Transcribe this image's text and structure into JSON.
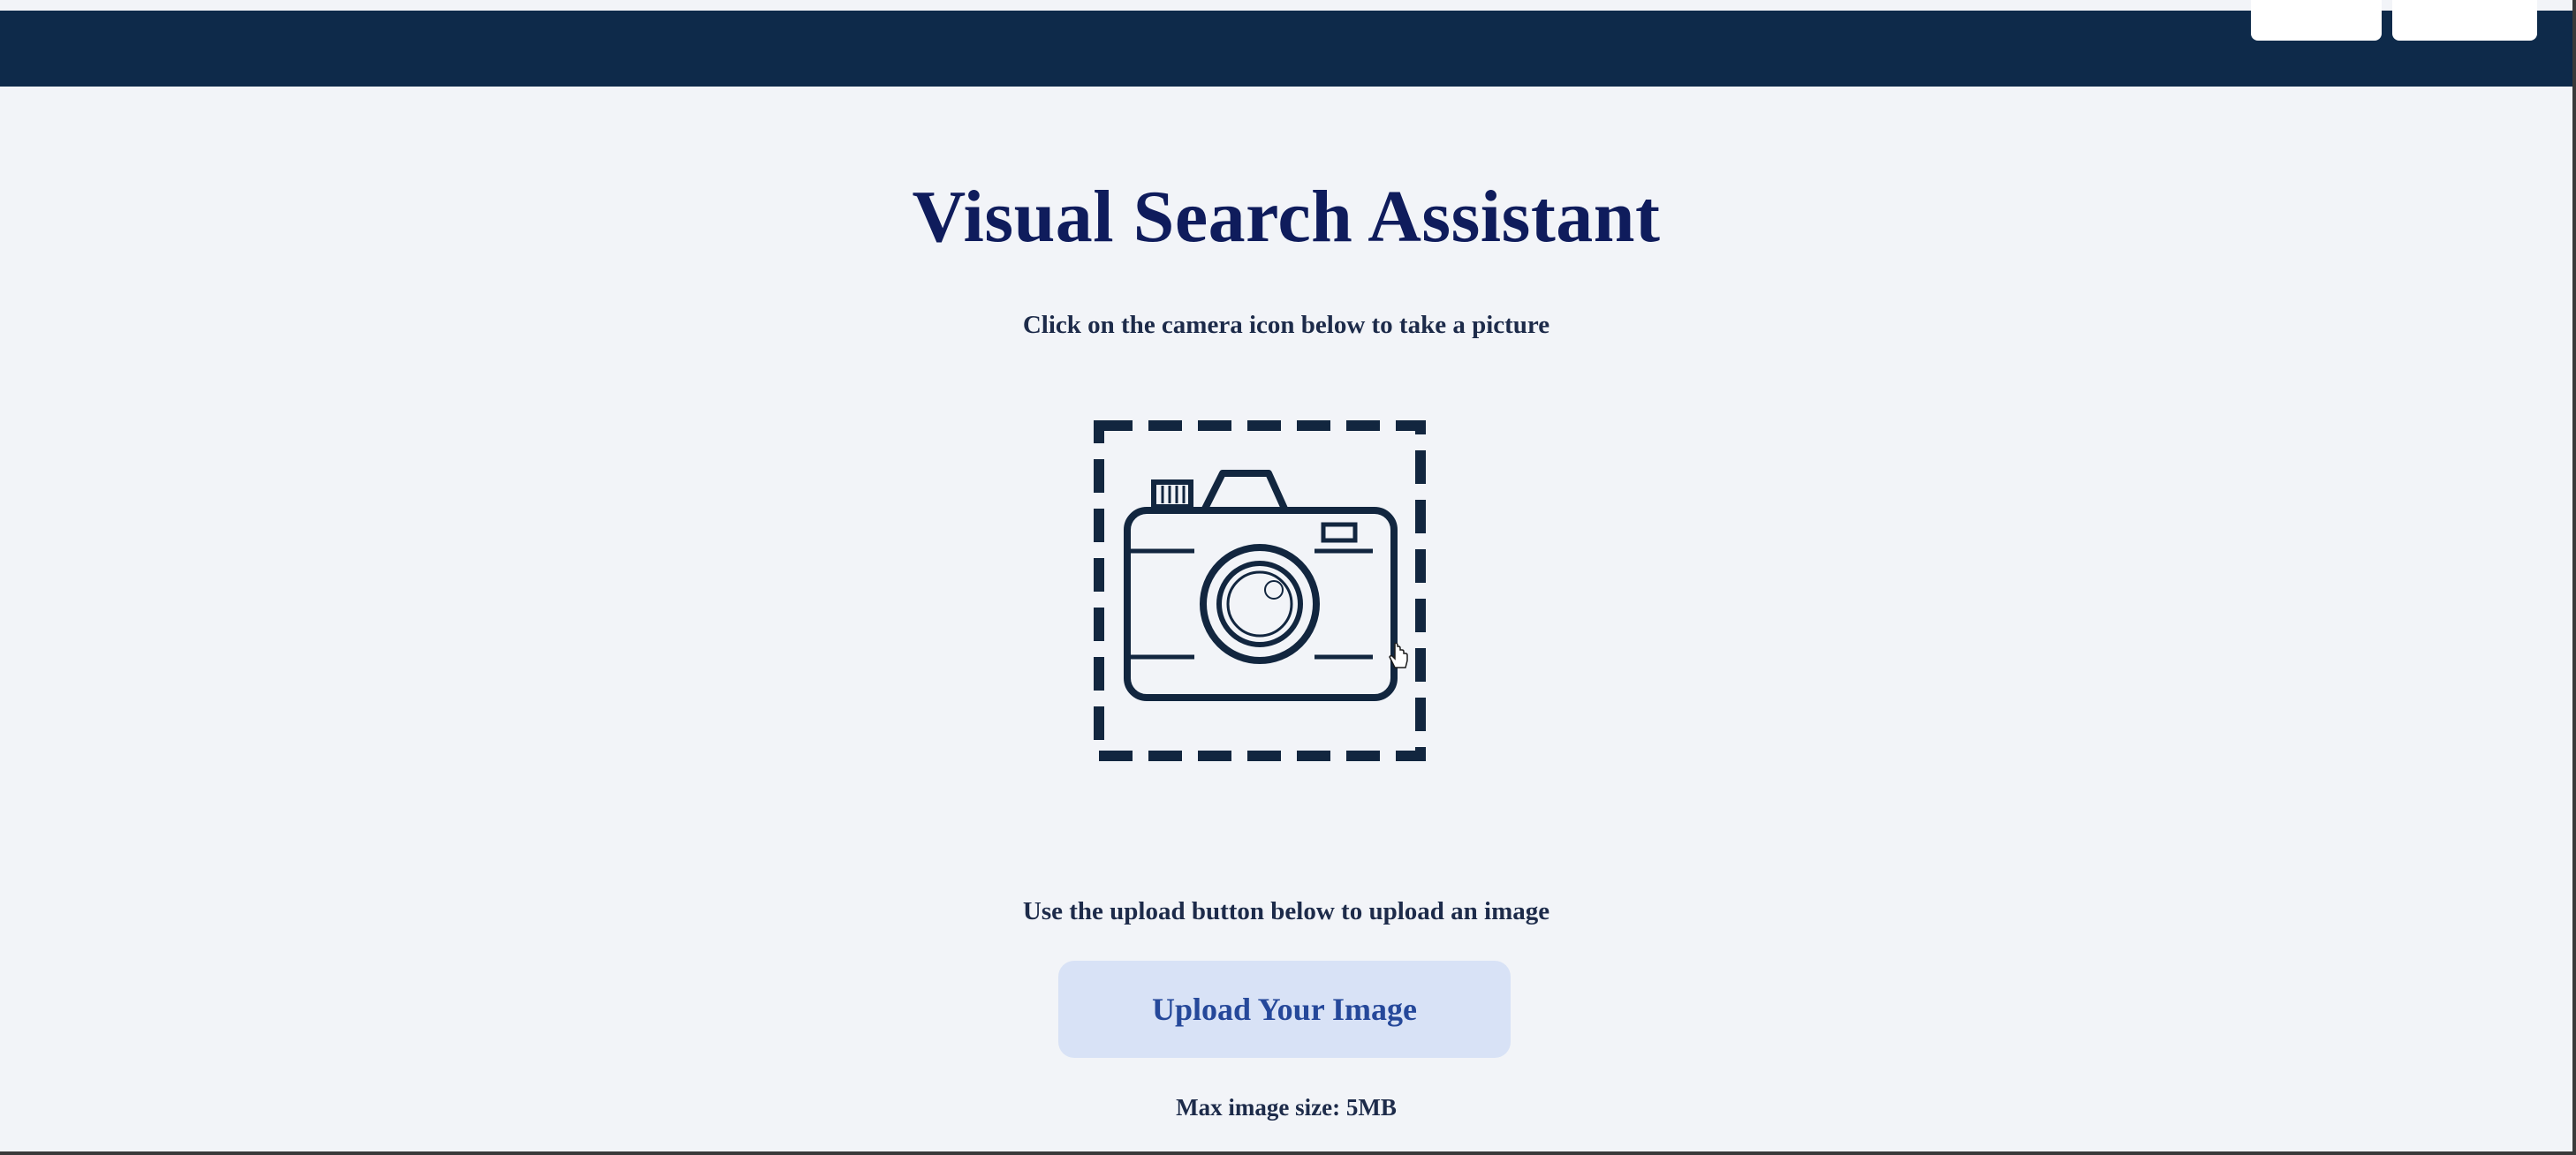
{
  "page": {
    "title": "Visual Search Assistant",
    "camera_hint": "Click on the camera icon below to take a picture",
    "upload_hint": "Use the upload button below to upload an image",
    "upload_button_label": "Upload Your Image",
    "max_size_note": "Max image size: 5MB"
  },
  "icons": {
    "camera": "camera-icon",
    "cursor": "hand-pointer-cursor"
  },
  "colors": {
    "topbar": "#0e2a4a",
    "background": "#f2f4f8",
    "title": "#0f1c5c",
    "upload_button_bg": "#d8e2f6",
    "upload_button_text": "#25489a"
  }
}
